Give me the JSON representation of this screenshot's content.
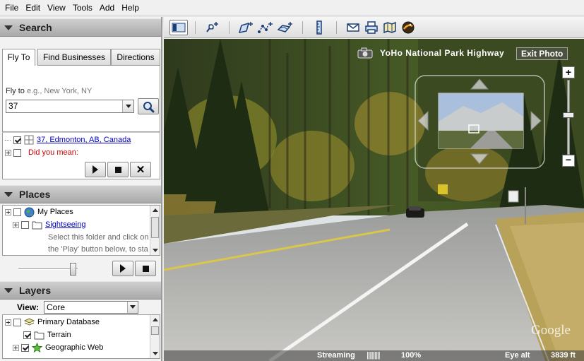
{
  "menu": [
    "File",
    "Edit",
    "View",
    "Tools",
    "Add",
    "Help"
  ],
  "search": {
    "title": "Search",
    "tabs": [
      "Fly To",
      "Find Businesses",
      "Directions"
    ],
    "active_tab": "Fly To",
    "flyto_label": "Fly to",
    "flyto_placeholder": "e.g., New York, NY",
    "query": "37",
    "results": [
      {
        "label": "37, Edmonton, AB, Canada",
        "checked": true
      },
      {
        "label": "Did you mean:",
        "checked": false
      }
    ]
  },
  "places": {
    "title": "Places",
    "items": [
      {
        "label": "My Places"
      },
      {
        "label": "Sightseeing"
      }
    ],
    "description_line1": "Select this folder and click on",
    "description_line2": "the 'Play' button below, to sta"
  },
  "layers": {
    "title": "Layers",
    "view_label": "View:",
    "view_value": "Core",
    "items": [
      {
        "label": "Primary Database"
      },
      {
        "label": "Terrain",
        "checked": true
      },
      {
        "label": "Geographic Web",
        "checked": true
      }
    ]
  },
  "viewport": {
    "photo_title": "YoHo National Park Highway",
    "exit_label": "Exit Photo",
    "status_streaming": "Streaming",
    "status_bars": "||||||||||",
    "status_percent": "100%",
    "eye_alt_label": "Eye alt",
    "eye_alt_value": "3839 ft",
    "watermark": "Google"
  },
  "icons": {
    "toolbar": [
      "sidebar-toggle-icon",
      "placemark-add-icon",
      "polygon-add-icon",
      "path-add-icon",
      "image-overlay-icon",
      "ruler-icon",
      "email-icon",
      "print-icon",
      "map-view-icon",
      "sky-icon"
    ]
  },
  "colors": {
    "link": "#0000cc",
    "warning": "#cc0000",
    "panel_header": "#b5b5b5"
  }
}
